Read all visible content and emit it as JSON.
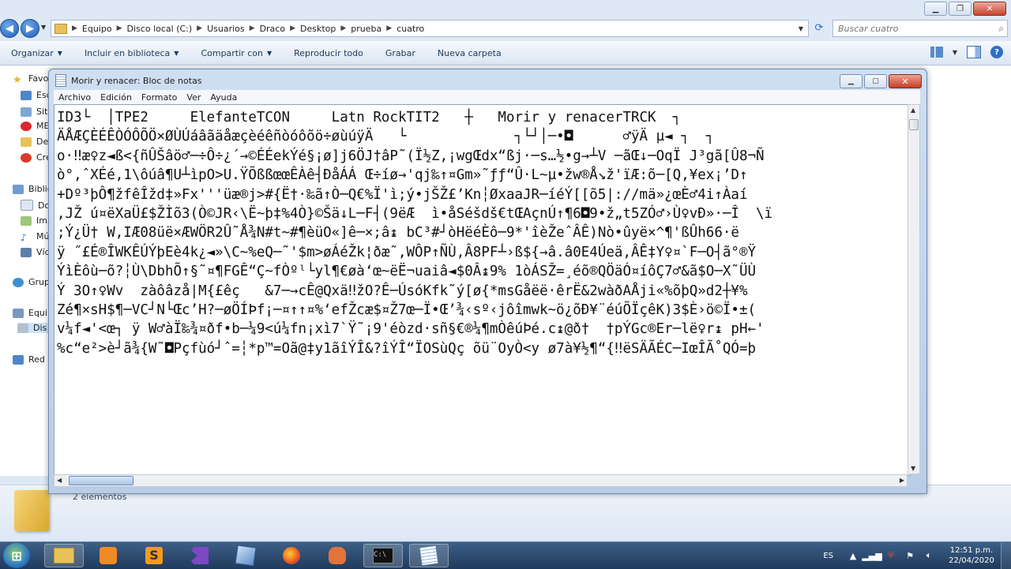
{
  "explorer": {
    "breadcrumbs": [
      "Equipo",
      "Disco local (C:)",
      "Usuarios",
      "Draco",
      "Desktop",
      "prueba",
      "cuatro"
    ],
    "search_placeholder": "Buscar cuatro",
    "commands": [
      {
        "label": "Organizar",
        "dropdown": true
      },
      {
        "label": "Incluir en biblioteca",
        "dropdown": true
      },
      {
        "label": "Compartir con",
        "dropdown": true
      },
      {
        "label": "Reproducir todo",
        "dropdown": false
      },
      {
        "label": "Grabar",
        "dropdown": false
      },
      {
        "label": "Nueva carpeta",
        "dropdown": false
      }
    ],
    "nav_items": [
      "Favo",
      "Esc",
      "Siti",
      "ME",
      "Des",
      "Cre",
      "Biblic",
      "Do",
      "Ima",
      "Mú",
      "Víd",
      "Grup",
      "Equip",
      "Dis",
      "Red"
    ],
    "status_text": "2 elementos"
  },
  "notepad": {
    "title": "Morir y renacer: Bloc de notas",
    "menus": [
      "Archivo",
      "Edición",
      "Formato",
      "Ver",
      "Ayuda"
    ],
    "content_lines": [
      "ID3└  │TPE2     ElefanteTCON     Latn RockTIT2   ┼   Morir y renacerTRCK  ┐",
      "ÄÅÆÇÈÉÊÒÓÔÕÖ×ØÙÚáâãäåæçèéêñòóôõö÷øùúÿÄ   └             ┐└┘│─•◘      ♂ÿÄ µ◄ ┐  ┐",
      "o·‼æ♀z◄ß<{ñÛŠâö♂─÷Ô÷¿´→©ÉÉekÝé§¡ø]j6ÖJ†âP˜(Ï½Z,¡wgŒdx“ßj·─s…½•g→┴V ─ãŒ↓─OqÏ J³gã[Û8¬Ñ",
      "ò°,ˆXÉé,1\\ôúâ¶U┴ìpO>U.ŸÕßßœœÊÀê┤ÐåÁÁ Œ÷íø→'qj‰↑¤Gm»˜ƒƒ“Û·L~µ•žw®Å↘ž'ïÆ:õ─[Q,¥ex¡’D↑",
      "+Dº³þÔ¶žfêÎžd‡»Fx'''üæ®j>#{Ë†·‰ã↑Ò─Q€%Ï'ì;ý•jŠŽ£’Kn┆ØxaaJR─íéÝ[[õ5|://mä»¿œÈ♂4i↑Àaí",
      ",JŽ ú¤ëXaÜ£$ŽÌõ3(Ò©JR‹\\Ë~þ‡%4Ò}©Šä↓L─F┤(9ëÆ  ì•åSéšdš€tŒAçnÚ↑¶6◘9•ž„t5ZÓ♂›Ù♀vÐ»·─Î  \\ï",
      ";Ý¿Ü† W,IÆ08üë×ÆWÖR2Û˜Å¾N#t~#¶èüO«]ê─×;â↨ bC³#┘òHëéÈô─9*'îèŽeˆÂÊ)Nò•ûyë×^¶'ßÛh66·ë",
      "ÿ ˝£É®ÎWKÊÚÝþEè4k¿◄»\\C~%eQ─˜'$m>øÁéŽk¦ðæ˜,WÔP↑ÑÙ,Â8PF┴›ß${→â.â0E4Úeä,ÂÊ‡Y♀¤`F─O┤ã°®Ÿ",
      "ÝìÈôù─õ?┆Ù\\DbhÕ↑§˜¤¶FGÊ“Ç~fÒºˡ└yl¶€øà‘œ~ëË¬uaiâ◄$0Â↨9% 1òÁSŽ=¸éõ®QÖäÓ¤íôÇ7♂&ã$O─X˜ÜÙ",
      "Ý 3O↑♀Wv  zàôâzå|M{£êç   &7─→cÊ@Qxä‼žO?Ê─ÚsóKfk˜ý[ø{*msGåëë·êrË&2wàðAÅji«%õþQ»d2┼¥%",
      "Zé¶×sH$¶─VC┘N└Œc’H?─øÖÍÞf¡─¤↑↑¤%‘efŽcæ$¤Ž7œ─Ï•Œ’¾‹sº‹jôîmwk~ö¿õÐ¥¨éúÕÏçêK)3$È›ö©Ï•±(",
      "v¼f◄'<œ┐ ÿ W♂àÏ‰¾¤ðf•b─¼9<ú¼fn¡xì7`Ÿ˜¡9'éòzd·sñ§€®¼¶mÒêúÞé.c↨@ð†  †pÝGc®Er─lë♀r↨ pH←'",
      "%c“e²>è┘ã¾{W˜◘Pçfùó┘ˆ=┆*p™=Oã@‡y1ãîÝÎ&?îÝÎ“ÏOSùQç õü¨OyÒ<y ø7à¥½¶“{‼ëSÄÃÉC─IœÎÃ˚QÓ=þ"
    ]
  },
  "taskbar": {
    "language": "ES",
    "time": "12:51 p.m.",
    "date": "22/04/2020"
  }
}
